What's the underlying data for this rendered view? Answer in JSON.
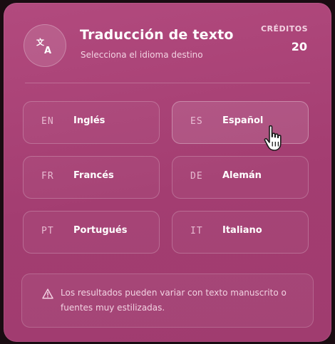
{
  "header": {
    "title": "Traducción de texto",
    "subtitle": "Selecciona el idioma destino",
    "logo_icon": "translate-icon"
  },
  "credits": {
    "label": "CRÉDITOS",
    "value": "20"
  },
  "languages": [
    {
      "code": "EN",
      "name": "Inglés",
      "selected": false
    },
    {
      "code": "ES",
      "name": "Español",
      "selected": true
    },
    {
      "code": "FR",
      "name": "Francés",
      "selected": false
    },
    {
      "code": "DE",
      "name": "Alemán",
      "selected": false
    },
    {
      "code": "PT",
      "name": "Portugués",
      "selected": false
    },
    {
      "code": "IT",
      "name": "Italiano",
      "selected": false
    }
  ],
  "notice": {
    "icon": "warning-icon",
    "text": "Los resultados pueden variar con texto manuscrito o fuentes muy estilizadas."
  },
  "colors": {
    "panel": "#a83f74",
    "text": "#ffffff"
  }
}
